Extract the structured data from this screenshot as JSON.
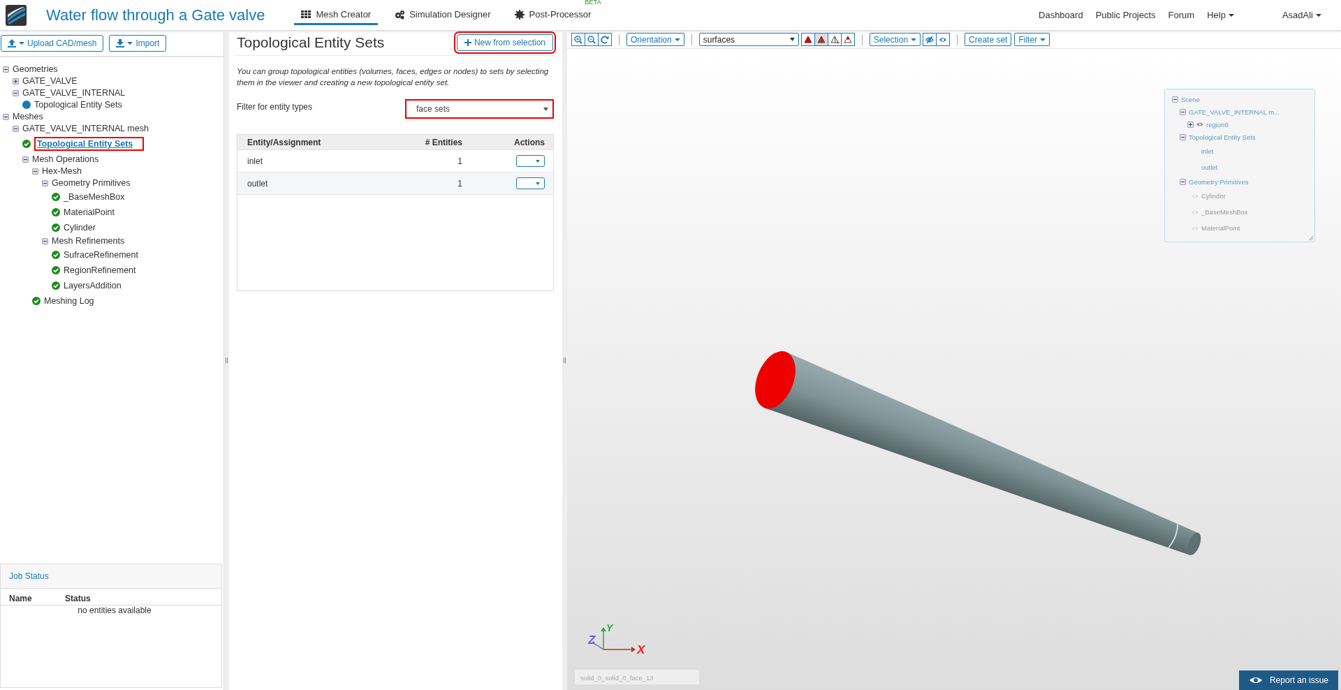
{
  "header": {
    "title": "Water flow through a Gate valve",
    "tabs": [
      {
        "label": "Mesh Creator",
        "selected": true
      },
      {
        "label": "Simulation Designer",
        "selected": false
      },
      {
        "label": "Post-Processor",
        "selected": false,
        "badge": "BETA"
      }
    ],
    "links": [
      "Dashboard",
      "Public Projects",
      "Forum"
    ],
    "menus": [
      "Help",
      "AsadAli"
    ]
  },
  "sidebar": {
    "buttons": [
      "Upload CAD/mesh",
      "Import"
    ],
    "tree": [
      {
        "label": "Geometries",
        "kind": "folder",
        "expanded": true,
        "selected": false,
        "children": [
          {
            "label": "GATE_VALVE",
            "kind": "folder",
            "expanded": false,
            "selected": false
          },
          {
            "label": "GATE_VALVE_INTERNAL",
            "kind": "folder",
            "expanded": true,
            "selected": false,
            "children": [
              {
                "label": "Topological Entity Sets",
                "kind": "set",
                "selected": false
              }
            ]
          }
        ]
      },
      {
        "label": "Meshes",
        "kind": "folder",
        "expanded": true,
        "selected": false,
        "children": [
          {
            "label": "GATE_VALVE_INTERNAL mesh",
            "kind": "folder",
            "expanded": true,
            "selected": false,
            "children": [
              {
                "label": "Topological Entity Sets",
                "kind": "done",
                "selected": true
              },
              {
                "label": "Mesh Operations",
                "kind": "folder",
                "expanded": true,
                "selected": false,
                "children": [
                  {
                    "label": "Hex-Mesh",
                    "kind": "folder",
                    "expanded": true,
                    "selected": false,
                    "children": [
                      {
                        "label": "Geometry Primitives",
                        "kind": "folder",
                        "expanded": true,
                        "selected": false,
                        "children": [
                          {
                            "label": "_BaseMeshBox",
                            "kind": "done",
                            "selected": false
                          },
                          {
                            "label": "MaterialPoint",
                            "kind": "done",
                            "selected": false
                          },
                          {
                            "label": "Cylinder",
                            "kind": "done",
                            "selected": false
                          }
                        ]
                      },
                      {
                        "label": "Mesh Refinements",
                        "kind": "folder",
                        "expanded": true,
                        "selected": false,
                        "children": [
                          {
                            "label": "SufraceRefinement",
                            "kind": "done",
                            "selected": false
                          },
                          {
                            "label": "RegionRefinement",
                            "kind": "done",
                            "selected": false
                          },
                          {
                            "label": "LayersAddition",
                            "kind": "done",
                            "selected": false
                          }
                        ]
                      }
                    ]
                  },
                  {
                    "label": "Meshing Log",
                    "kind": "done",
                    "selected": false
                  }
                ]
              }
            ]
          }
        ]
      }
    ],
    "job_status": {
      "title": "Job Status",
      "columns": [
        "Name",
        "Status"
      ],
      "empty": "no entities available"
    }
  },
  "panel": {
    "title": "Topological Entity Sets",
    "new_button": "New from selection",
    "description": "You can group topological entities (volumes, faces, edges or nodes) to sets by selecting them in the viewer and creating a new topological entity set.",
    "filter_label": "Filter for entity types",
    "filter_value": "face sets",
    "table": {
      "columns": [
        "Entity/Assignment",
        "# Entities",
        "Actions"
      ],
      "rows": [
        {
          "name": "inlet",
          "count": "1"
        },
        {
          "name": "outlet",
          "count": "1"
        }
      ]
    }
  },
  "viewer": {
    "toolbar": {
      "orientation": "Orientation",
      "display": "surfaces",
      "render_modes": [
        {
          "kind": "solid",
          "selected": false
        },
        {
          "kind": "edged",
          "selected": true
        },
        {
          "kind": "wire",
          "selected": false
        },
        {
          "kind": "points",
          "selected": false
        }
      ],
      "selection": "Selection",
      "create_set": "Create set",
      "filter": "Filter"
    },
    "scene_tree": [
      {
        "label": "Scene",
        "kind": "folder",
        "expanded": true,
        "children": [
          {
            "label": "GATE_VALVE_INTERNAL m...",
            "kind": "folder",
            "expanded": true,
            "children": [
              {
                "label": "region0",
                "kind": "item",
                "expanded": false,
                "visible": true
              }
            ]
          },
          {
            "label": "Topological Entity Sets",
            "kind": "folder",
            "expanded": true,
            "children": [
              {
                "label": "inlet",
                "kind": "leaf"
              },
              {
                "label": "outlet",
                "kind": "leaf"
              }
            ]
          },
          {
            "label": "Geometry Primitives",
            "kind": "folder",
            "expanded": true,
            "children": [
              {
                "label": "Cylinder",
                "kind": "item",
                "visible": false
              },
              {
                "label": "_BaseMeshBox",
                "kind": "item",
                "visible": false
              },
              {
                "label": "MaterialPoint",
                "kind": "item",
                "visible": false
              }
            ]
          }
        ]
      }
    ],
    "axes": {
      "x": "X",
      "y": "Y",
      "z": "Z"
    },
    "picked_entity": "solid_0_solid_0_face_13",
    "report_button": "Report an issue"
  }
}
